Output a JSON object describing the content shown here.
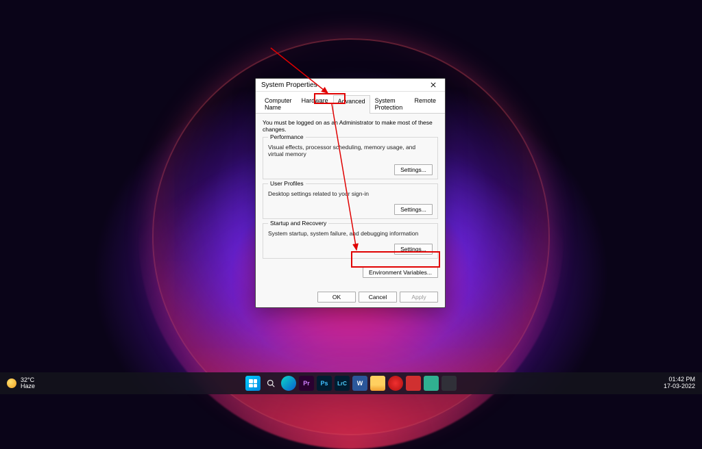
{
  "dialog": {
    "title": "System Properties",
    "tabs": [
      "Computer Name",
      "Hardware",
      "Advanced",
      "System Protection",
      "Remote"
    ],
    "active_tab": 2,
    "instruction": "You must be logged on as an Administrator to make most of these changes.",
    "groups": {
      "performance": {
        "title": "Performance",
        "desc": "Visual effects, processor scheduling, memory usage, and virtual memory",
        "button": "Settings..."
      },
      "profiles": {
        "title": "User Profiles",
        "desc": "Desktop settings related to your sign-in",
        "button": "Settings..."
      },
      "startup": {
        "title": "Startup and Recovery",
        "desc": "System startup, system failure, and debugging information",
        "button": "Settings..."
      }
    },
    "env_button": "Environment Variables...",
    "buttons": {
      "ok": "OK",
      "cancel": "Cancel",
      "apply": "Apply"
    }
  },
  "taskbar": {
    "weather": {
      "temp": "32°C",
      "cond": "Haze"
    },
    "time": "01:42 PM",
    "date": "17-03-2022"
  }
}
